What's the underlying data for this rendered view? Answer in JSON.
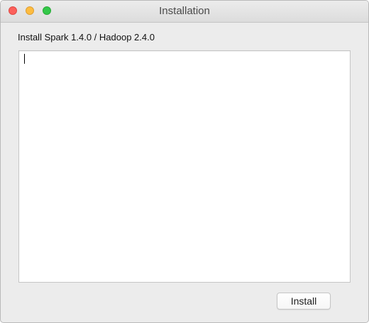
{
  "window": {
    "title": "Installation",
    "controls": {
      "close_color": "#fc605b",
      "minimize_color": "#fdbc40",
      "zoom_color": "#34c84a"
    }
  },
  "content": {
    "heading": "Install Spark 1.4.0 / Hadoop 2.4.0",
    "log_text": "",
    "install_button_label": "Install"
  }
}
